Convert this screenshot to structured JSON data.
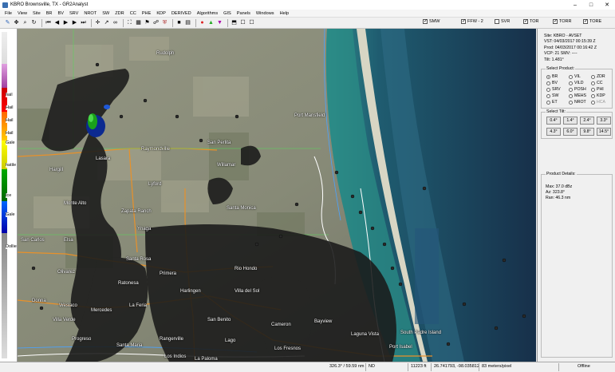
{
  "window": {
    "title": "KBRO Brownsville, TX - GR2Analyst"
  },
  "menu": [
    "File",
    "View",
    "Site",
    "BR",
    "BV",
    "SRV",
    "NROT",
    "SW",
    "ZDR",
    "CC",
    "PHE",
    "KDP",
    "DERIVED",
    "Algorithms",
    "GIS",
    "Panels",
    "Windows",
    "Help"
  ],
  "checkboxes": [
    {
      "label": "SMW",
      "checked": true
    },
    {
      "label": "FFW - 2",
      "checked": true
    },
    {
      "label": "SVR",
      "checked": false
    },
    {
      "label": "TOR",
      "checked": true
    },
    {
      "label": "TORR",
      "checked": true
    },
    {
      "label": "TORE",
      "checked": true
    }
  ],
  "colorbar": {
    "labels": [
      "hail",
      "Hail",
      "Hail",
      "Hail",
      "Gale",
      "",
      "",
      "hatile",
      "",
      "Ice",
      "",
      "Gale",
      "Dollie"
    ]
  },
  "towns": [
    "Rudolph",
    "Raymondville",
    "San Perlita",
    "Lasara",
    "Hargill",
    "Willamar",
    "Lyford",
    "Monte Alto",
    "Zapata Ranch",
    "Santa Monica",
    "Ynaga",
    "San Carlos",
    "Elsa",
    "Santa Rosa",
    "Olivarez",
    "Primera",
    "Rio Hondo",
    "Ratonesa",
    "Donna",
    "Weslaco",
    "Mercedes",
    "La Feria",
    "Harlingen",
    "Villa del Sol",
    "Villa Verde",
    "San Benito",
    "Bayview",
    "Cameron",
    "Progreso",
    "Santa Maria",
    "Rangerville",
    "Lago",
    "Los Fresnos",
    "Laguna Vista",
    "South Padre Island",
    "Port Isabel",
    "Los Indios",
    "La Paloma",
    "Port Mansfield"
  ],
  "site_info": {
    "site": "Site:   KBRO - AVSET",
    "vcp_time": "VST:   04/03/2017  00:15:39 Z",
    "prod_time": "Prod:   04/03/2017  00:16:42 Z",
    "vcp": "VCP:   21          SMV:  ----",
    "tilt": "Tilt:   1.481°"
  },
  "select_product": {
    "title": "Select Product:",
    "items": [
      {
        "label": "BR",
        "on": true,
        "dis": false
      },
      {
        "label": "VIL",
        "on": false,
        "dis": false
      },
      {
        "label": "ZDR",
        "on": false,
        "dis": false
      },
      {
        "label": "BV",
        "on": false,
        "dis": false
      },
      {
        "label": "VILD",
        "on": false,
        "dis": false
      },
      {
        "label": "CC",
        "on": false,
        "dis": false
      },
      {
        "label": "SRV",
        "on": false,
        "dis": false
      },
      {
        "label": "POSH",
        "on": false,
        "dis": false
      },
      {
        "label": "PHI",
        "on": false,
        "dis": false
      },
      {
        "label": "SW",
        "on": false,
        "dis": false
      },
      {
        "label": "MEHS",
        "on": false,
        "dis": false
      },
      {
        "label": "KDP",
        "on": false,
        "dis": false
      },
      {
        "label": "ET",
        "on": false,
        "dis": false
      },
      {
        "label": "NROT",
        "on": false,
        "dis": false
      },
      {
        "label": "HCA",
        "on": false,
        "dis": true
      }
    ]
  },
  "select_tilt": {
    "title": "Select Tilt:",
    "items": [
      "0.4°",
      "1.4°",
      "2.4°",
      "3.3°",
      "4.3°",
      "6.0°",
      "9.8°",
      "14.5°"
    ]
  },
  "product_details": {
    "title": "Product Details:",
    "max": "Max:  37.0 dBz",
    "az": "Az:  323.8°",
    "ran": "Ran:  46.3 nm"
  },
  "status": {
    "azran": "326.3° / 59.59 nm",
    "nd": "ND",
    "height": "11223 ft",
    "latlon": "26.741793, -98.035812",
    "res": "83 meters/pixel",
    "mode": "Offline"
  },
  "colors": {
    "water": "#1c3e5e",
    "land": "#8d8e7c",
    "echo": "#161616",
    "road": "#e8912a"
  }
}
